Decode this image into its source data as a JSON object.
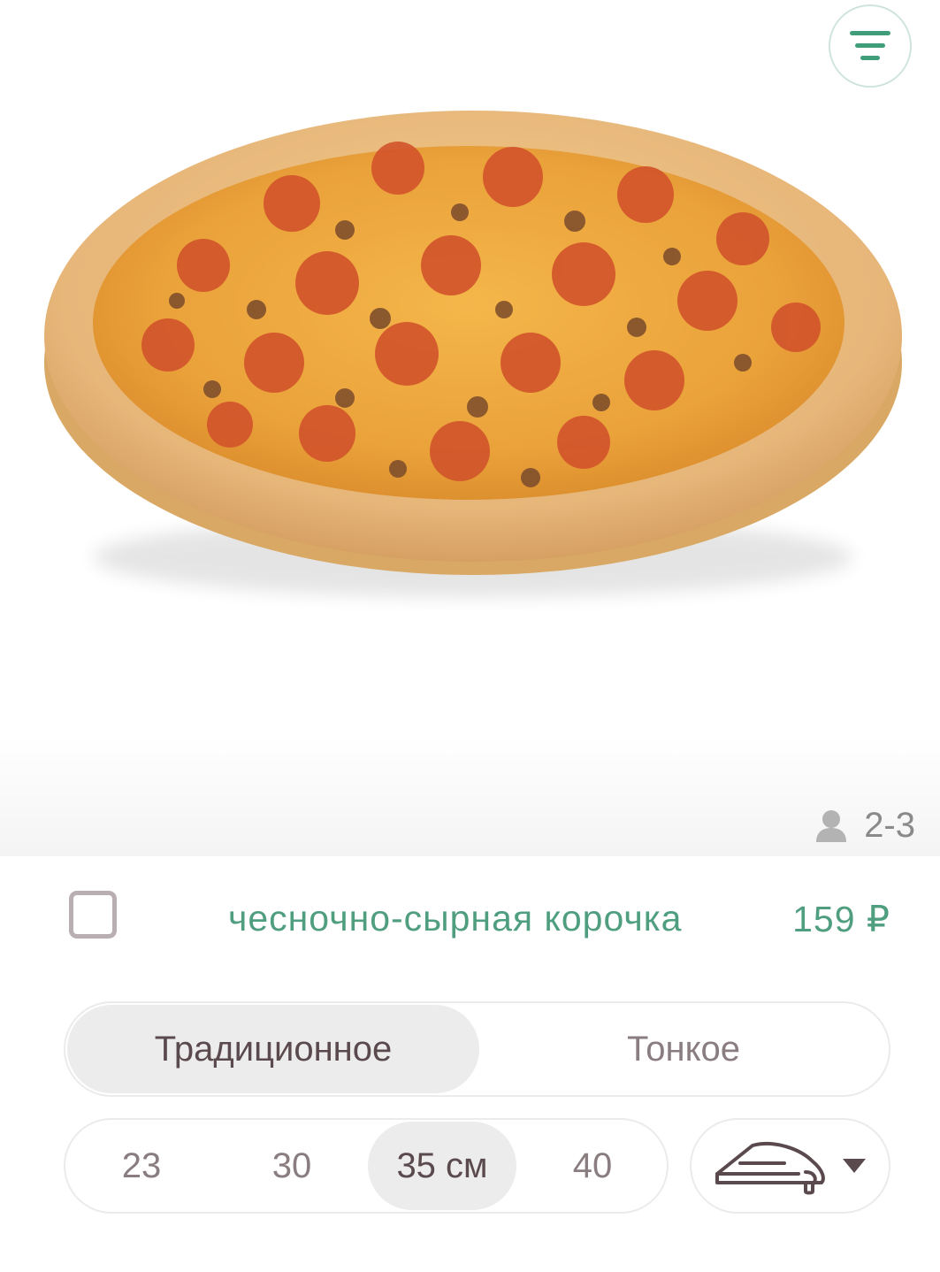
{
  "filter_button": {
    "icon": "filter-lines-icon"
  },
  "hero": {
    "persons_icon": "person-icon",
    "persons": "2-3"
  },
  "crust_option": {
    "label": "чесночно-сырная корочка",
    "price": "159 ₽",
    "checked": false
  },
  "dough_types": [
    {
      "label": "Традиционное",
      "selected": true
    },
    {
      "label": "Тонкое",
      "selected": false
    }
  ],
  "sizes": [
    {
      "label": "23",
      "selected": false
    },
    {
      "label": "30",
      "selected": false
    },
    {
      "label": "35 см",
      "selected": true
    },
    {
      "label": "40",
      "selected": false
    }
  ],
  "crust_type_select": {
    "icon": "pizza-slice-cheese-icon",
    "dropdown_icon": "triangle-down-icon"
  },
  "colors": {
    "accent": "#4f9e7f",
    "text_muted": "#8a7d80",
    "text_active": "#5a4a4e",
    "pill_active": "#ececec"
  }
}
